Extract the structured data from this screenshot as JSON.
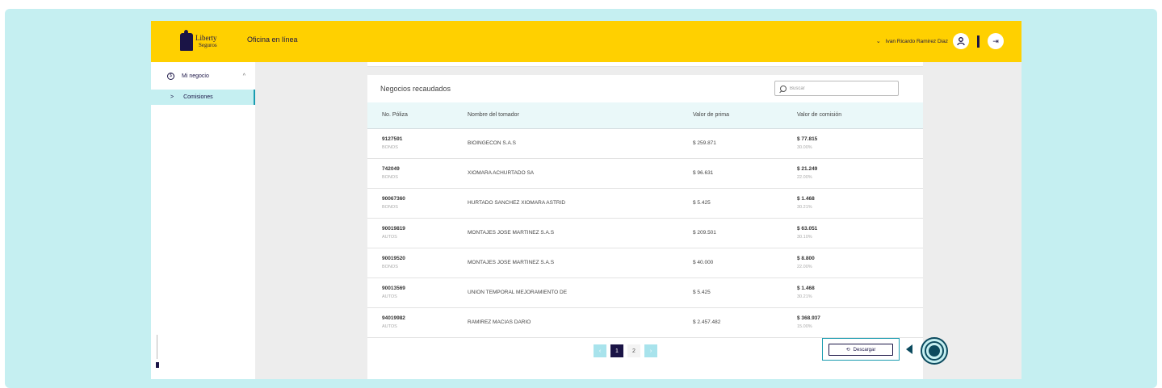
{
  "header": {
    "logo_line1": "Liberty",
    "logo_line2": "Seguros",
    "app_title": "Oficina en línea",
    "user_name": "Ivan Ricardo Ramirez Diaz",
    "chevron": "⌄",
    "logout_icon": "⇥"
  },
  "sidebar": {
    "section_label": "Mi negocio",
    "section_caret": "^",
    "sub_arrow": ">",
    "sub_item_label": "Comisiones"
  },
  "card": {
    "title": "Negocios recaudados",
    "search_placeholder": "Buscar",
    "columns": [
      "No. Póliza",
      "Nombre del tomador",
      "Valor de prima",
      "Valor de comisión"
    ],
    "rows": [
      {
        "policy": "9127591",
        "branch": "BONOS",
        "holder": "BIOINGECON S.A.S",
        "premium": "$ 259.871",
        "commission": "$ 77.815",
        "rate": "30.00%"
      },
      {
        "policy": "742049",
        "branch": "BONOS",
        "holder": "XIOMARA ACHURTADO SA",
        "premium": "$ 96.631",
        "commission": "$ 21.249",
        "rate": "22.00%"
      },
      {
        "policy": "90067360",
        "branch": "BONOS",
        "holder": "HURTADO SANCHEZ XIOMARA ASTRID",
        "premium": "$ 5.425",
        "commission": "$ 1.468",
        "rate": "30.21%"
      },
      {
        "policy": "90019819",
        "branch": "AUTOS",
        "holder": "MONTAJES JOSE MARTINEZ S.A.S",
        "premium": "$ 209.501",
        "commission": "$ 63.051",
        "rate": "30.10%"
      },
      {
        "policy": "90019520",
        "branch": "BONOS",
        "holder": "MONTAJES JOSE MARTINEZ S.A.S",
        "premium": "$ 40.000",
        "commission": "$ 8.800",
        "rate": "22.00%"
      },
      {
        "policy": "90013569",
        "branch": "AUTOS",
        "holder": "UNION TEMPORAL MEJORAMIENTO DE",
        "premium": "$ 5.425",
        "commission": "$ 1.468",
        "rate": "30.21%"
      },
      {
        "policy": "94019982",
        "branch": "AUTOS",
        "holder": "RAMIREZ MACIAS DARIO",
        "premium": "$ 2.457.482",
        "commission": "$ 368.937",
        "rate": "15.00%"
      }
    ]
  },
  "pagination": {
    "prev": "‹",
    "pages": [
      "1",
      "2"
    ],
    "current": "1",
    "next": "›"
  },
  "download": {
    "label": "Descargar",
    "icon": "⟲"
  },
  "colors": {
    "brand_yellow": "#ffd000",
    "brand_navy": "#1a1446",
    "accent_teal": "#1a9cb0",
    "background_cyan": "#c5eff1"
  }
}
